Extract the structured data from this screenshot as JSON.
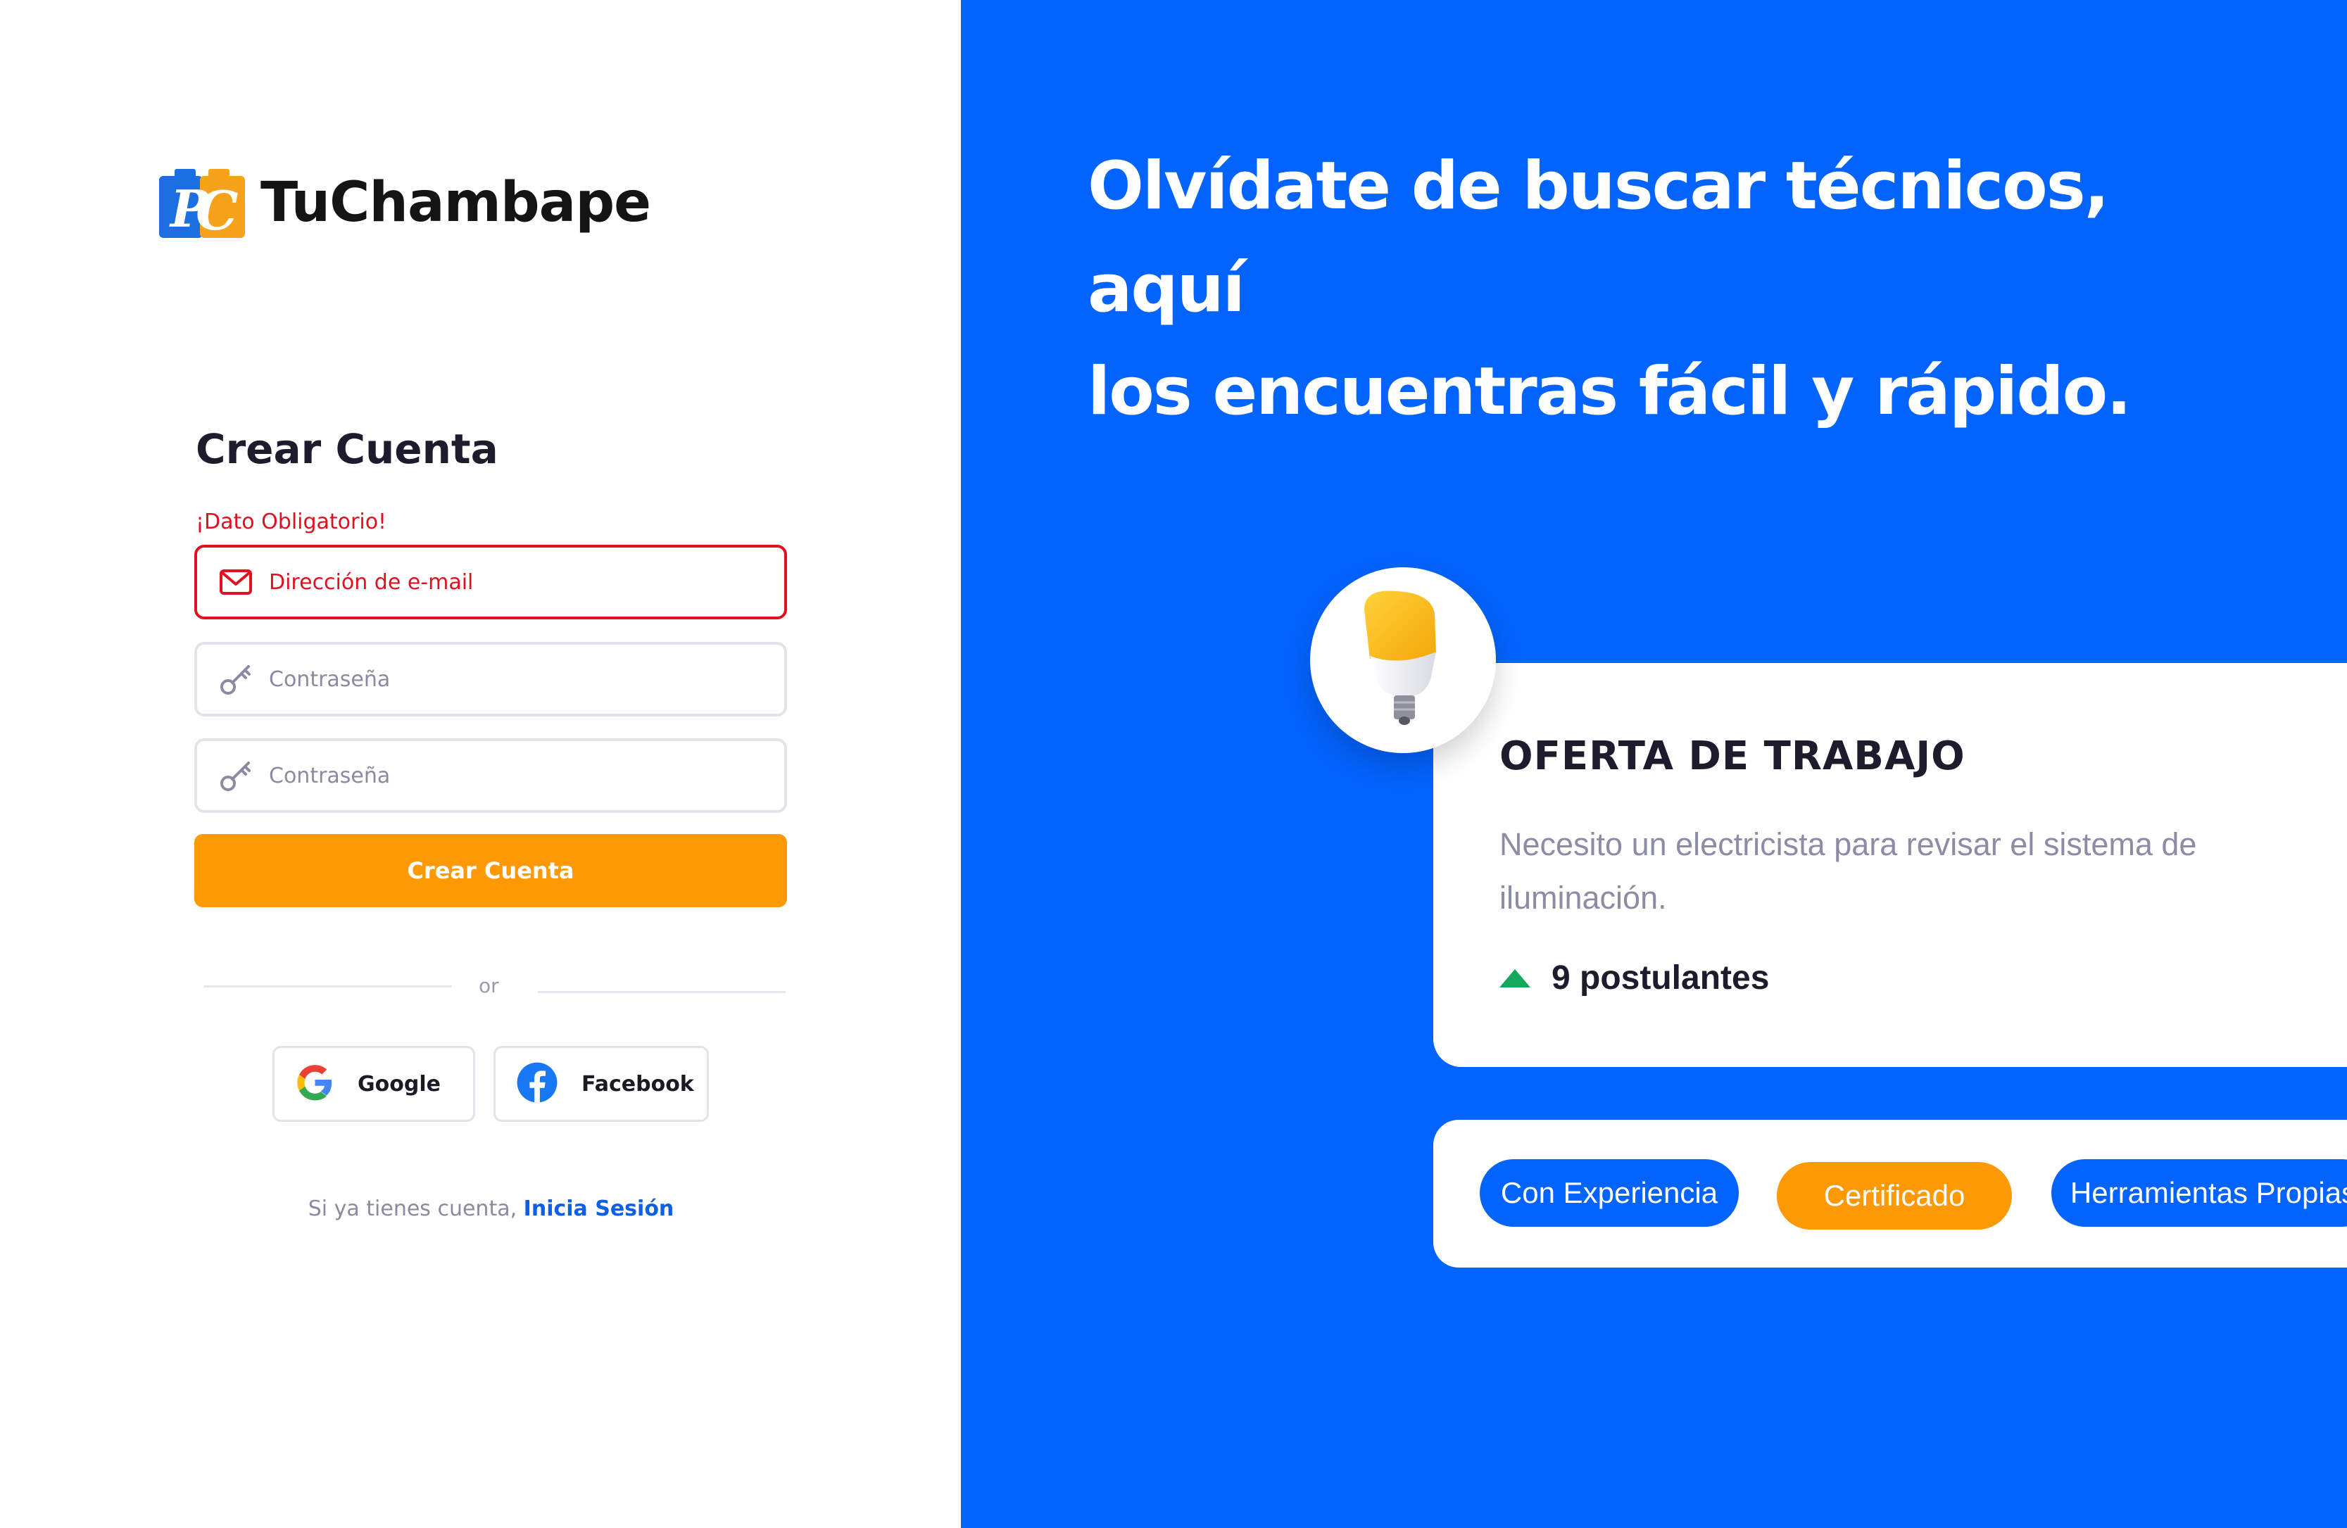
{
  "brand": {
    "name": "TuChambape",
    "colors": {
      "primary": "#0363fd",
      "accent": "#fc9904",
      "error": "#e0101f"
    }
  },
  "form": {
    "title": "Crear Cuenta",
    "required_message": "¡Dato Obligatorio!",
    "email_label": "Dirección de e-mail",
    "password_label": "Contraseña",
    "password_confirm_label": "Contraseña",
    "submit_label": "Crear Cuenta",
    "or_text": "or"
  },
  "social": {
    "google_label": "Google",
    "facebook_label": "Facebook"
  },
  "signin": {
    "prompt": "Si ya tienes cuenta, ",
    "link_label": "Inicia Sesión"
  },
  "hero": {
    "headline_line1": "Olvídate de buscar técnicos, aquí",
    "headline_line2": "los encuentras fácil y rápido.",
    "job_card": {
      "title": "OFERTA DE TRABAJO",
      "description": "Necesito un electricista para revisar el sistema de iluminación.",
      "applicants": "9 postulantes"
    },
    "tags": [
      "Con Experiencia",
      "Certificado",
      "Herramientas Propias"
    ]
  },
  "icons": {
    "email": "mail-icon",
    "password": "key-icon",
    "google": "google-icon",
    "facebook": "facebook-icon",
    "bulb": "light-bulb-icon",
    "trend": "up-triangle-icon"
  }
}
